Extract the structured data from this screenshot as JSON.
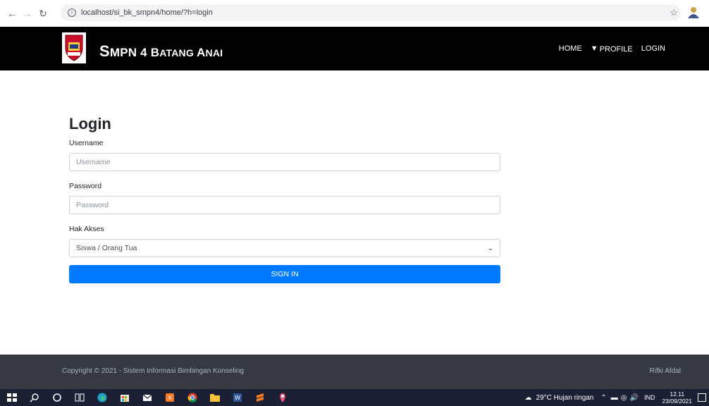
{
  "browser": {
    "url": "localhost/si_bk_smpn4/home/?h=login"
  },
  "navbar": {
    "brand_initial": "S",
    "brand_rest_part1": "MPN 4 ",
    "brand_B": "B",
    "brand_atang": "ATANG ",
    "brand_A": "A",
    "brand_nai": "NAI",
    "links": {
      "home": "HOME",
      "profile": "PROFILE",
      "login": "LOGIN"
    }
  },
  "form": {
    "title": "Login",
    "username_label": "Username",
    "username_placeholder": "Username",
    "password_label": "Password",
    "password_placeholder": "Password",
    "akses_label": "Hak Akses",
    "akses_selected": "Siswa / Orang Tua",
    "submit_label": "SIGN IN"
  },
  "footer": {
    "copyright": "Copyright © 2021 - Sistem Informasi Bimbingan Konseling",
    "author": "Rifki Afdal"
  },
  "taskbar": {
    "weather": "29°C  Hujan ringan",
    "language": "IND",
    "time": "12.11",
    "date": "23/09/2021"
  },
  "colors": {
    "navbar": "#000000",
    "primary": "#007bff",
    "footer": "#343a40",
    "taskbar": "#1b2034"
  }
}
